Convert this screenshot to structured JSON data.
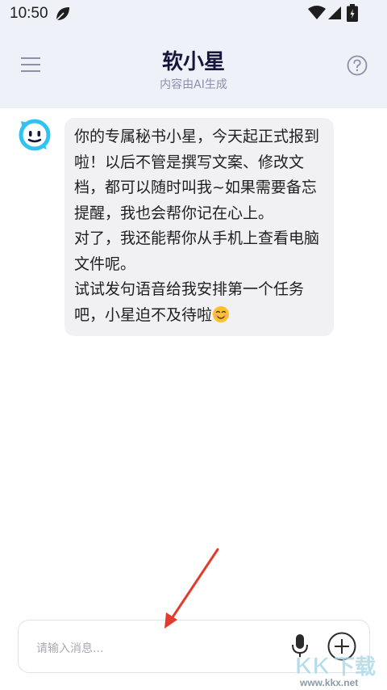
{
  "status_bar": {
    "time": "10:50",
    "icons": [
      "leaf-icon",
      "wifi-icon",
      "signal-icon",
      "battery-icon"
    ]
  },
  "header": {
    "title": "软小星",
    "subtitle": "内容由AI生成",
    "left_icon": "menu-icon",
    "right_icon": "help-icon"
  },
  "chat": {
    "messages": [
      {
        "sender": "assistant",
        "avatar_icon": "bot-avatar-icon",
        "text": "你的专属秘书小星，今天起正式报到啦！以后不管是撰写文案、修改文档，都可以随时叫我~如果需要备忘提醒，我也会帮你记在心上。\n对了，我还能帮你从手机上查看电脑文件呢。\n试试发句语音给我安排第一个任务吧，小星迫不及待啦",
        "emoji": "smiling-face-emoji"
      }
    ]
  },
  "composer": {
    "placeholder": "请输入消息...",
    "mic_icon": "microphone-icon",
    "add_icon": "plus-circle-icon"
  },
  "overlay": {
    "annotation": "red-arrow-annotation",
    "watermark_logo": "KK下载",
    "watermark_url": "www.kkx.net"
  },
  "colors": {
    "header_bg": "#eef1f8",
    "bubble_bg": "#f1f1f3",
    "title": "#15163a",
    "avatar_accent": "#2fc3f0",
    "annotation": "#e23b2e"
  }
}
